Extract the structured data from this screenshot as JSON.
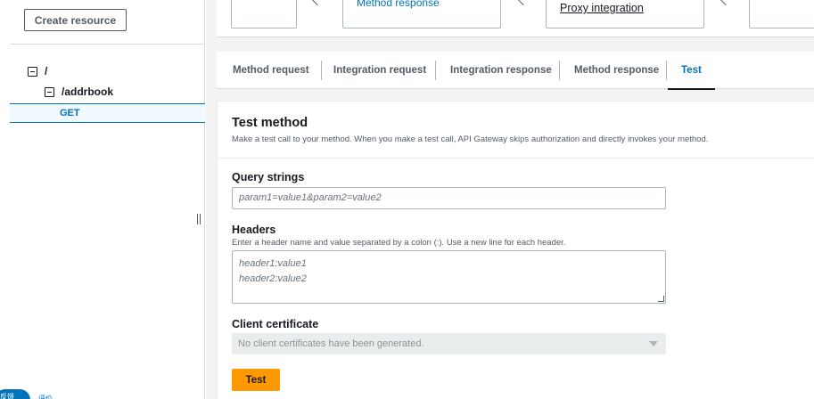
{
  "sidebar": {
    "create_button": "Create resource",
    "tree": {
      "root": "/",
      "child": "/addrbook",
      "method": "GET"
    },
    "chat": {
      "bubble_text": "反馈",
      "side_text": "评价"
    }
  },
  "flow": {
    "method_response": "Method response",
    "proxy_integration": "Proxy integration"
  },
  "tabs": [
    {
      "label": "Method request"
    },
    {
      "label": "Integration request"
    },
    {
      "label": "Integration response"
    },
    {
      "label": "Method response"
    },
    {
      "label": "Test",
      "active": true
    }
  ],
  "test_method": {
    "title": "Test method",
    "description": "Make a test call to your method. When you make a test call, API Gateway skips authorization and directly invokes your method.",
    "query_strings": {
      "label": "Query strings",
      "placeholder": "param1=value1&param2=value2"
    },
    "headers": {
      "label": "Headers",
      "description": "Enter a header name and value separated by a colon (:). Use a new line for each header.",
      "placeholder_line1": "header1:value1",
      "placeholder_line2": "header2:value2"
    },
    "client_certificate": {
      "label": "Client certificate",
      "value": "No client certificates have been generated."
    },
    "test_button": "Test"
  },
  "colors": {
    "accent": "#0073bb",
    "primary_button": "#ff9900"
  }
}
